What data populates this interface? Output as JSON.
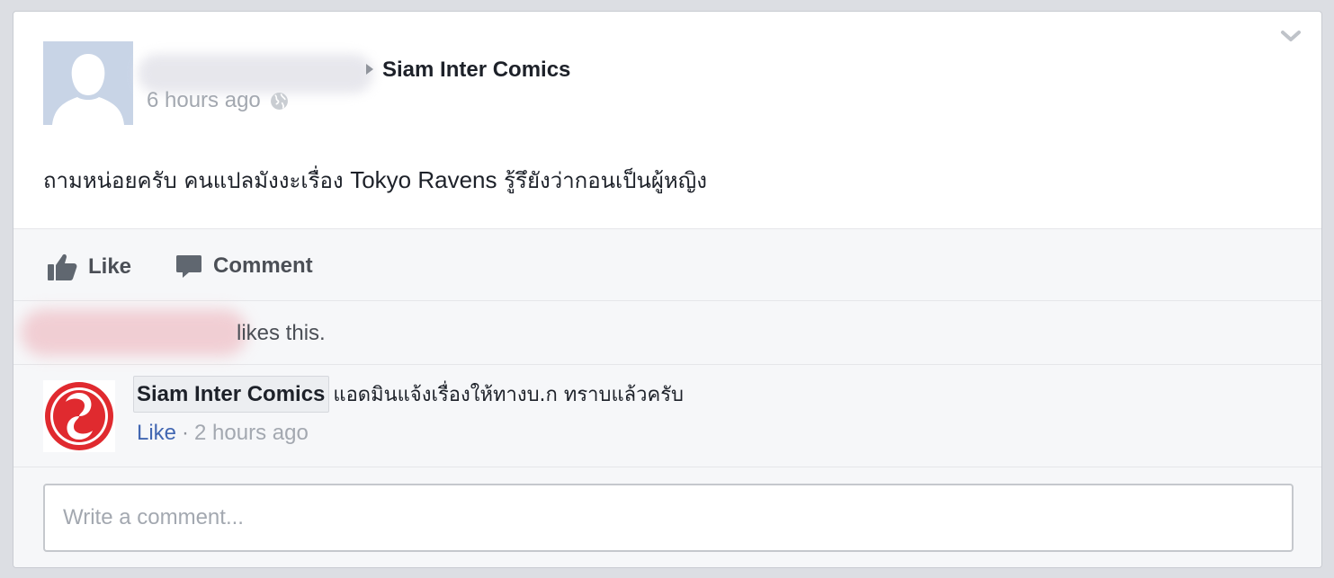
{
  "post": {
    "page_name": "Siam Inter Comics",
    "timestamp": "6 hours ago",
    "text_thai_before": "ถามหน่อยครับ คนแปลมังงะเรื่อง ",
    "text_latin": "Tokyo Ravens",
    "text_thai_after": " รู้รึยังว่ากอนเป็นผู้หญิง"
  },
  "actions": {
    "like_label": "Like",
    "comment_label": "Comment"
  },
  "likes": {
    "text": "likes this."
  },
  "comment": {
    "author": "Siam Inter Comics",
    "text": "แอดมินแจ้งเรื่องให้ทางบ.ก ทราบแล้วครับ",
    "like_label": "Like",
    "separator": "·",
    "time": "2 hours ago"
  },
  "comment_input": {
    "placeholder": "Write a comment..."
  },
  "colors": {
    "link_blue": "#4267b2",
    "brand_red": "#e02a2f"
  }
}
